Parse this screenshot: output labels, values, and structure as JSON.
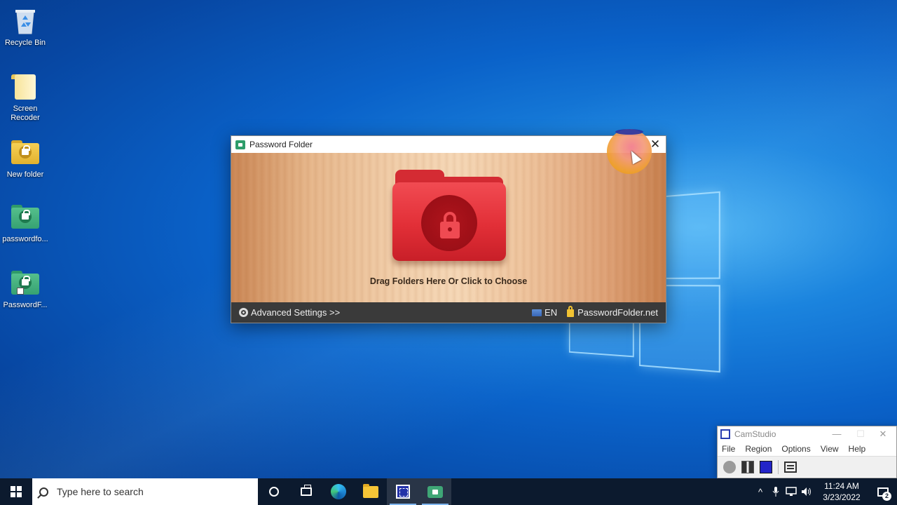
{
  "desktop": {
    "icons": [
      {
        "label": "Recycle Bin"
      },
      {
        "label": "Screen Recoder"
      },
      {
        "label": "New folder"
      },
      {
        "label": "passwordfo..."
      },
      {
        "label": "PasswordF..."
      }
    ]
  },
  "password_folder": {
    "title": "Password Folder",
    "close_glyph": "✕",
    "hint": "Drag Folders Here Or Click to Choose",
    "advanced_settings": "Advanced Settings >>",
    "language": "EN",
    "website": "PasswordFolder.net",
    "colors": {
      "folder": "#e22f37",
      "footer": "#3a3a3a"
    }
  },
  "camstudio": {
    "title": "CamStudio",
    "minimize_glyph": "—",
    "maximize_glyph": "☐",
    "close_glyph": "✕",
    "menu": [
      "File",
      "Region",
      "Options",
      "View",
      "Help"
    ]
  },
  "taskbar": {
    "search_placeholder": "Type here to search",
    "tray": {
      "chevron": "^",
      "time": "11:24 AM",
      "date": "3/23/2022",
      "notification_count": "2"
    },
    "colors": {
      "background": "#0c1a2e"
    }
  }
}
